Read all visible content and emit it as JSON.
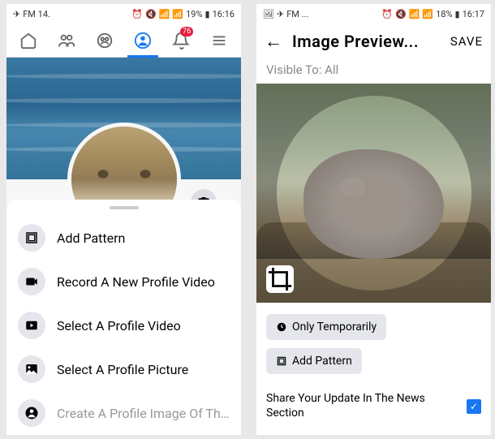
{
  "left": {
    "status": {
      "carrier": "FM 14.",
      "battery": "19%",
      "time": "16:16"
    },
    "nav": {
      "notif_badge": "76"
    },
    "sheet": {
      "add_pattern": "Add Pattern",
      "record_video": "Record A New Profile Video",
      "select_video": "Select A Profile Video",
      "select_picture": "Select A Profile Picture",
      "create_avatar": "Create A Profile Image Of The A..."
    }
  },
  "right": {
    "status": {
      "carrier": "FM ...",
      "battery": "18%",
      "time": "16:17"
    },
    "header": {
      "title": "Image Preview...",
      "save": "SAVE"
    },
    "visible_to": "Visible To: All",
    "only_temp": "Only Temporarily",
    "add_pattern": "Add Pattern",
    "share_text": "Share Your Update In The News Section"
  }
}
